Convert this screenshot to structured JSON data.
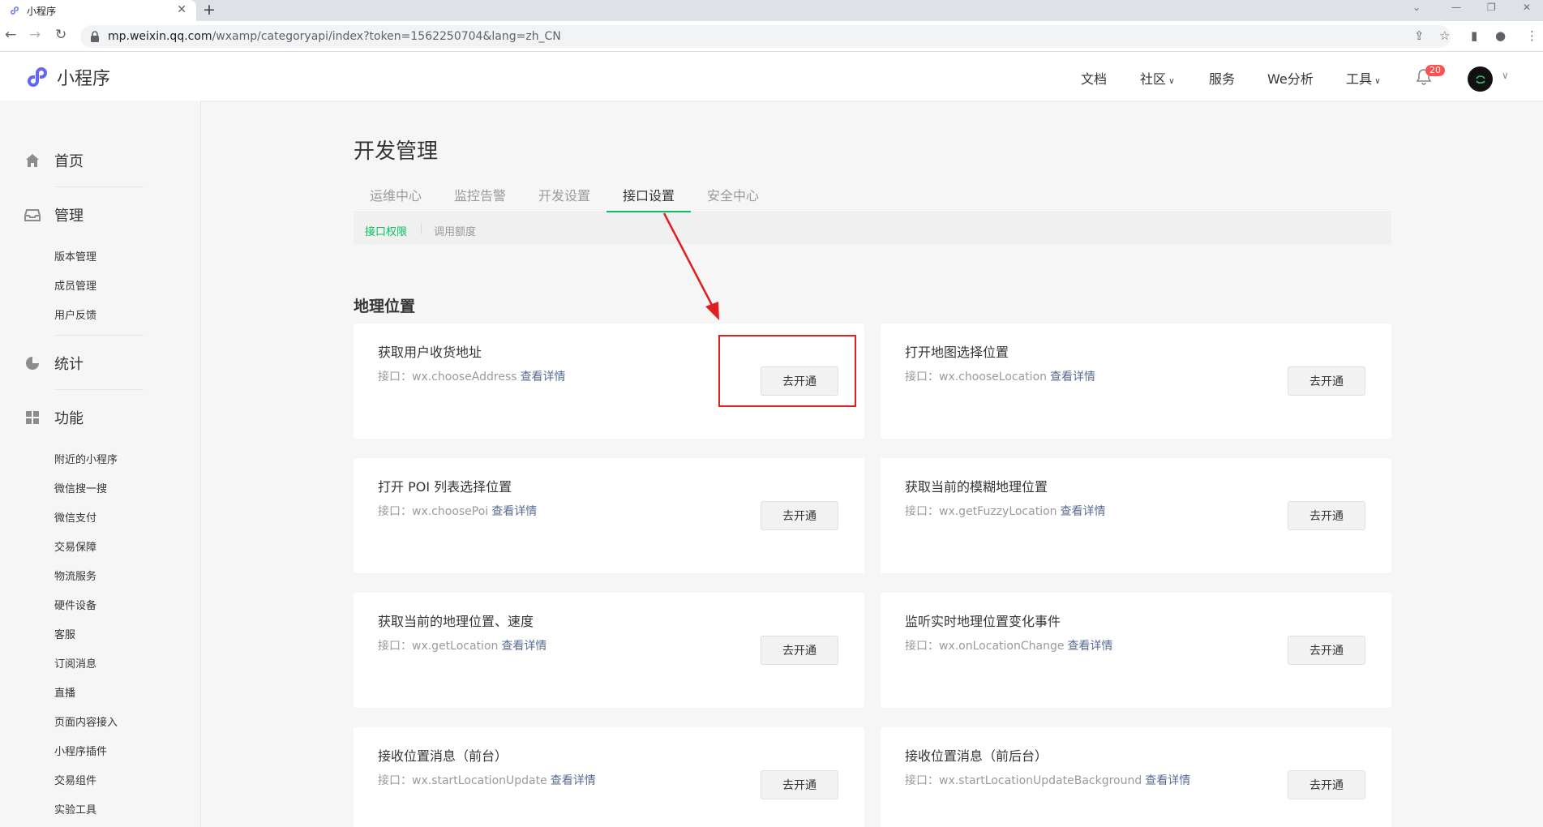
{
  "browser": {
    "tab_title": "小程序",
    "url_host": "mp.weixin.qq.com",
    "url_path": "/wxamp/categoryapi/index?token=1562250704&lang=zh_CN",
    "new_tab_glyph": "+",
    "close_glyph": "✕"
  },
  "header": {
    "brand": "小程序",
    "nav": [
      "文档",
      "社区",
      "服务",
      "We分析",
      "工具"
    ],
    "notification_count": "20",
    "accent_color": "#07c160"
  },
  "sidebar": {
    "groups": [
      {
        "label": "首页",
        "icon": "home-icon"
      },
      {
        "label": "管理",
        "icon": "inbox-icon",
        "items": [
          "版本管理",
          "成员管理",
          "用户反馈"
        ]
      },
      {
        "label": "统计",
        "icon": "pie-chart-icon"
      },
      {
        "label": "功能",
        "icon": "grid-icon",
        "items": [
          "附近的小程序",
          "微信搜一搜",
          "微信支付",
          "交易保障",
          "物流服务",
          "硬件设备",
          "客服",
          "订阅消息",
          "直播",
          "页面内容接入",
          "小程序插件",
          "交易组件",
          "实验工具"
        ]
      }
    ]
  },
  "main": {
    "title": "开发管理",
    "tabs": [
      "运维中心",
      "监控告警",
      "开发设置",
      "接口设置",
      "安全中心"
    ],
    "active_tab": "接口设置",
    "subtabs": [
      "接口权限",
      "调用额度"
    ],
    "section_title": "地理位置",
    "api_prefix": "接口：",
    "detail_label": "查看详情",
    "button_label": "去开通",
    "cards": [
      {
        "title": "获取用户收货地址",
        "api": "wx.chooseAddress"
      },
      {
        "title": "打开地图选择位置",
        "api": "wx.chooseLocation"
      },
      {
        "title": "打开 POI 列表选择位置",
        "api": "wx.choosePoi"
      },
      {
        "title": "获取当前的模糊地理位置",
        "api": "wx.getFuzzyLocation"
      },
      {
        "title": "获取当前的地理位置、速度",
        "api": "wx.getLocation"
      },
      {
        "title": "监听实时地理位置变化事件",
        "api": "wx.onLocationChange"
      },
      {
        "title": "接收位置消息（前台）",
        "api": "wx.startLocationUpdate"
      },
      {
        "title": "接收位置消息（前后台）",
        "api": "wx.startLocationUpdateBackground"
      }
    ]
  }
}
